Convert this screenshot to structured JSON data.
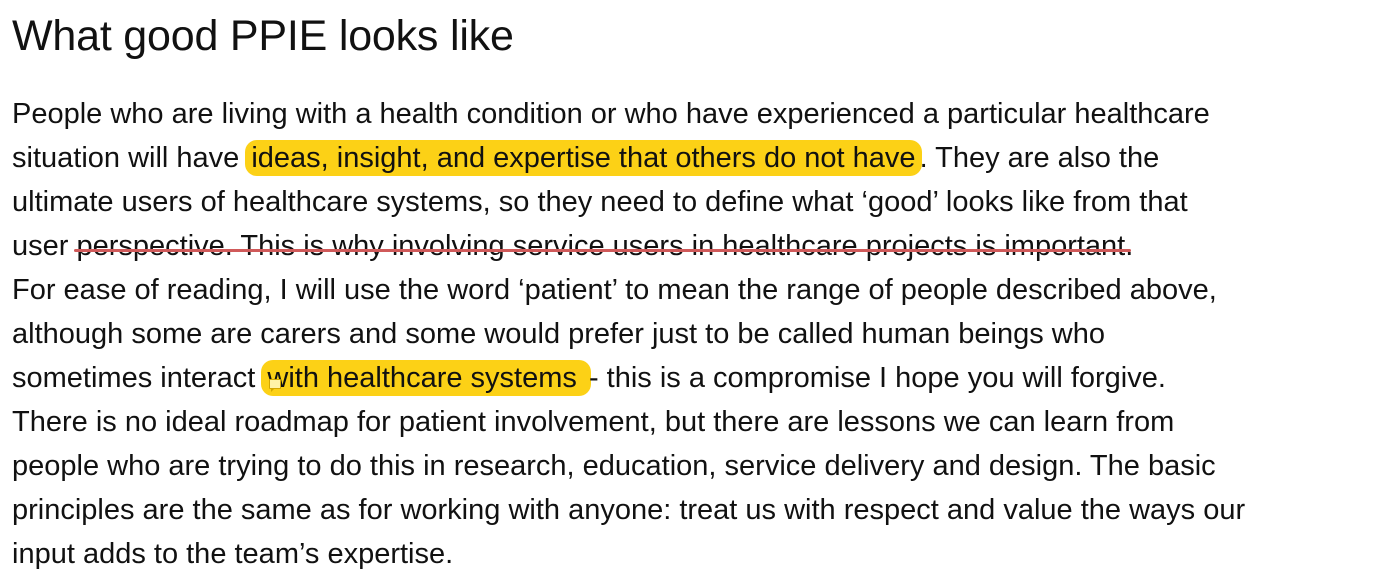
{
  "document": {
    "title": "What good PPIE looks like",
    "lines": {
      "l1": "People who are living with a health condition or who have experienced a particular healthcare",
      "l2_pre": "situation will have ",
      "l2_highlight": "ideas, insight, and expertise that others do not have",
      "l2_post": ". They are also the",
      "l3": "ultimate users of healthcare systems, so they need to define what ‘good’ looks like from that",
      "l4_pre": "user ",
      "l4_struck": "perspective. This is why involving service users in healthcare projects is important",
      "l4_post": ".",
      "l5": "For ease of reading, I will use the word ‘patient’ to mean the range of people described above,",
      "l6": "although some are carers and some would prefer just to be called human beings who",
      "l7_pre": "sometimes interact ",
      "l7_highlight": "with healthcare systems ",
      "l7_post": " - this is a compromise I hope you will forgive.",
      "l8": "There is no ideal roadmap for patient involvement, but there are lessons we can learn from",
      "l9": "people who are trying to do this in research, education, service delivery and design. The basic",
      "l10": "principles are the same as for working with anyone: treat us with respect and value the ways our",
      "l11": "input adds to the team’s expertise."
    }
  },
  "styles": {
    "highlight_color": "#fcd116",
    "strikethrough_color": "#d05a5a",
    "comment_icon": "comment-icon"
  }
}
